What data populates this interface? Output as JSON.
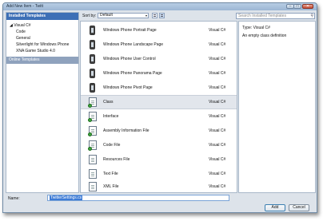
{
  "window": {
    "title": "Add New Item - Twitt",
    "controls": {
      "minimize": "–",
      "maximize": "□",
      "close": "✕"
    }
  },
  "left_pane": {
    "header": "Installed Templates",
    "tree": [
      {
        "label": "◢ Visual C#",
        "level": 0
      },
      {
        "label": "Code",
        "level": 1
      },
      {
        "label": "General",
        "level": 1
      },
      {
        "label": "Silverlight for Windows Phone",
        "level": 1
      },
      {
        "label": "XNA Game Studio 4.0",
        "level": 1
      }
    ],
    "online": "Online Templates"
  },
  "toolbar": {
    "sort_label": "Sort by:",
    "sort_value": "Default",
    "sort_arrow": "▾",
    "search_placeholder": "Search Installed Templates",
    "search_icon": "search-icon"
  },
  "templates": [
    {
      "name": "Windows Phone Portrait Page",
      "lang": "Visual C#",
      "icon": "phone-icon"
    },
    {
      "name": "Windows Phone Landscape Page",
      "lang": "Visual C#",
      "icon": "phone-icon"
    },
    {
      "name": "Windows Phone User Control",
      "lang": "Visual C#",
      "icon": "phone-icon"
    },
    {
      "name": "Windows Phone Panorama Page",
      "lang": "Visual C#",
      "icon": "phone-icon"
    },
    {
      "name": "Windows Phone Pivot Page",
      "lang": "Visual C#",
      "icon": "phone-icon"
    },
    {
      "name": "Class",
      "lang": "Visual C#",
      "icon": "class-file-icon",
      "selected": true
    },
    {
      "name": "Interface",
      "lang": "Visual C#",
      "icon": "interface-file-icon"
    },
    {
      "name": "Assembly Information File",
      "lang": "Visual C#",
      "icon": "assembly-info-icon"
    },
    {
      "name": "Code File",
      "lang": "Visual C#",
      "icon": "code-file-icon"
    },
    {
      "name": "Resources File",
      "lang": "Visual C#",
      "icon": "resources-file-icon"
    },
    {
      "name": "Text File",
      "lang": "Visual C#",
      "icon": "text-file-icon"
    },
    {
      "name": "XML File",
      "lang": "Visual C#",
      "icon": "xml-file-icon"
    }
  ],
  "info": {
    "type": "Type:  Visual C#",
    "description": "An empty class definition"
  },
  "bottom": {
    "name_label": "Name:",
    "name_value": "TwitterSettings.cs",
    "add_label": "Add",
    "cancel_label": "Cancel"
  },
  "colors": {
    "header_blue": "#3d6fb6",
    "online_bar": "#8fa2bd",
    "selected_row": "#e2e6ec"
  }
}
